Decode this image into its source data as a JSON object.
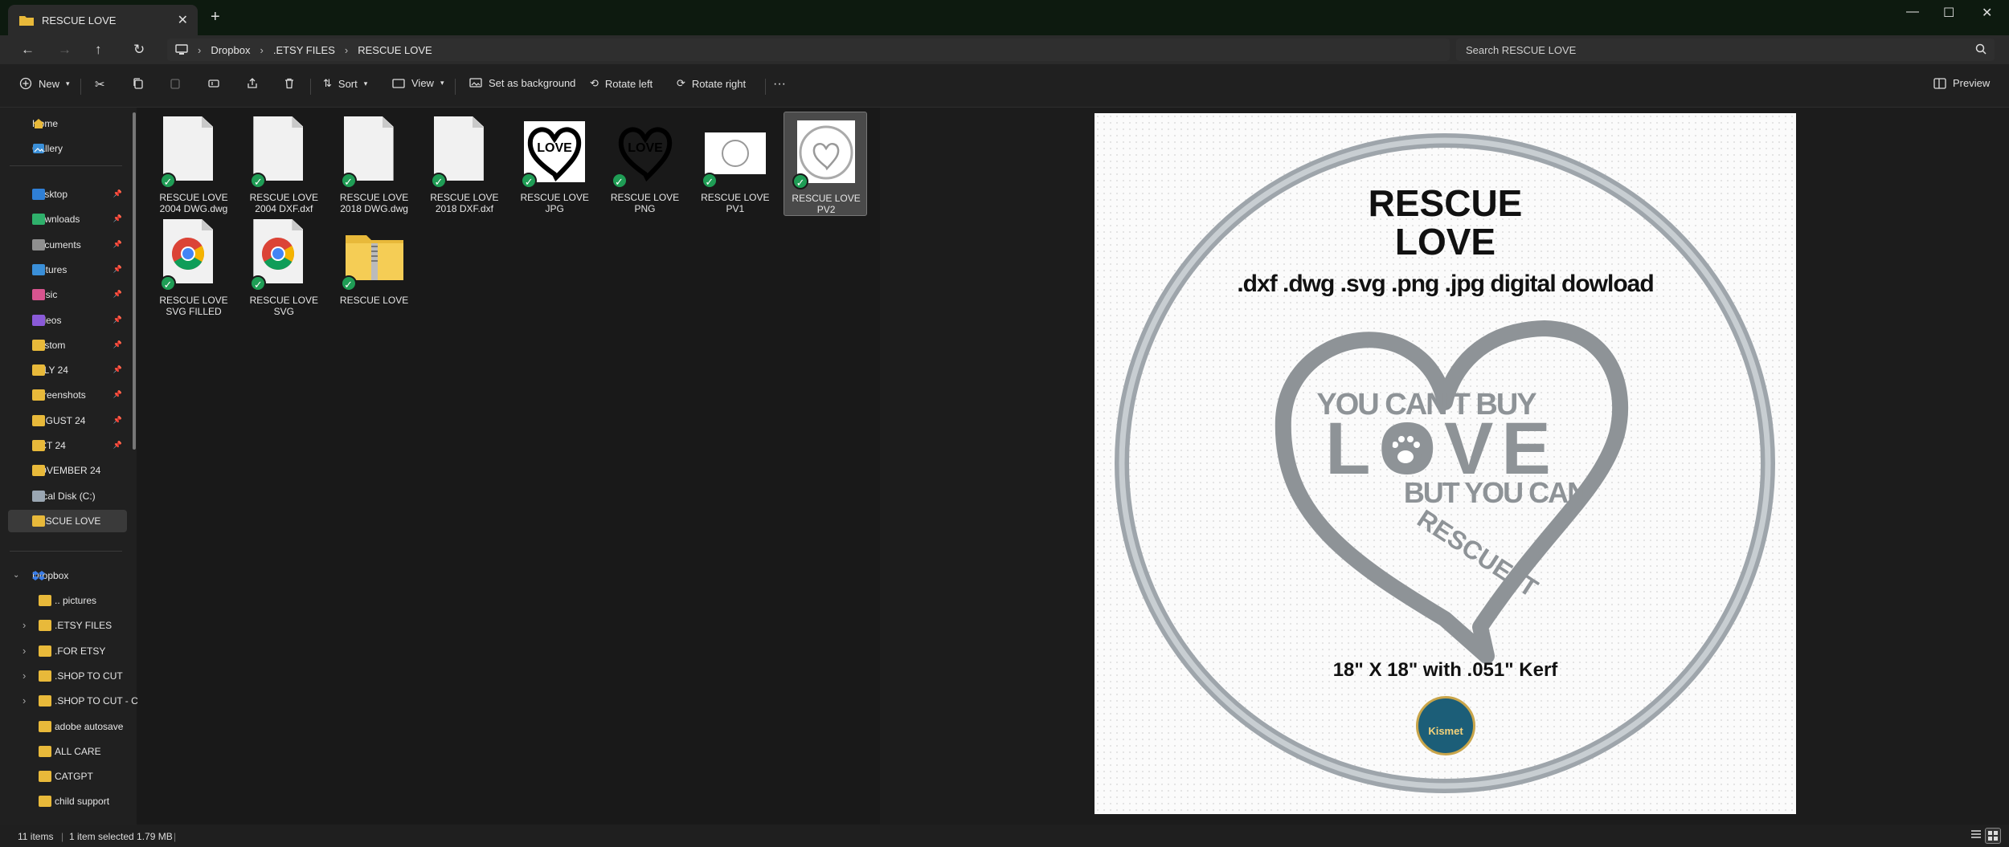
{
  "window": {
    "tab_title": "RESCUE LOVE",
    "new_tab": "+",
    "minimize": "—",
    "maximize": "☐",
    "close": "✕"
  },
  "address": {
    "breadcrumbs": [
      "Dropbox",
      ".ETSY FILES",
      "RESCUE LOVE"
    ],
    "search_placeholder": "Search RESCUE LOVE"
  },
  "toolbar": {
    "new_label": "New",
    "sort_label": "Sort",
    "view_label": "View",
    "set_background_label": "Set as background",
    "rotate_left_label": "Rotate left",
    "rotate_right_label": "Rotate right",
    "more_label": "···",
    "preview_label": "Preview"
  },
  "nav": {
    "home": "Home",
    "gallery": "Gallery",
    "pinned": [
      {
        "label": "Desktop",
        "color": "#2f7fd6"
      },
      {
        "label": "Downloads",
        "color": "#2fb06b"
      },
      {
        "label": "Documents",
        "color": "#8f8f8f"
      },
      {
        "label": "Pictures",
        "color": "#3a8fd8"
      },
      {
        "label": "Music",
        "color": "#d7548f"
      },
      {
        "label": "Videos",
        "color": "#8a5ad8"
      },
      {
        "label": "Custom",
        "color": "#e8b93a"
      },
      {
        "label": "JULY 24",
        "color": "#e8b93a"
      },
      {
        "label": "Screenshots",
        "color": "#e8b93a"
      },
      {
        "label": "AUGUST 24",
        "color": "#e8b93a"
      },
      {
        "label": "OCT 24",
        "color": "#e8b93a"
      },
      {
        "label": "NOVEMBER 24",
        "color": "#e8b93a"
      },
      {
        "label": "Local Disk (C:)",
        "color": "#9aa6b2"
      },
      {
        "label": "RESCUE LOVE",
        "color": "#e8b93a"
      }
    ],
    "dropbox": "Dropbox",
    "dropbox_children": [
      ".. pictures",
      ".ETSY FILES",
      ".FOR ETSY",
      ".SHOP TO CUT",
      ".SHOP TO CUT - C",
      "adobe autosave",
      "ALL CARE",
      "CATGPT",
      "child support"
    ]
  },
  "files": [
    {
      "line1": "RESCUE LOVE",
      "line2": "2004 DWG.dwg"
    },
    {
      "line1": "RESCUE LOVE",
      "line2": "2004 DXF.dxf"
    },
    {
      "line1": "RESCUE LOVE",
      "line2": "2018 DWG.dwg"
    },
    {
      "line1": "RESCUE LOVE",
      "line2": "2018 DXF.dxf"
    },
    {
      "line1": "RESCUE LOVE",
      "line2": "JPG"
    },
    {
      "line1": "RESCUE LOVE",
      "line2": "PNG"
    },
    {
      "line1": "RESCUE LOVE",
      "line2": "PV1"
    },
    {
      "line1": "RESCUE LOVE",
      "line2": "PV2"
    },
    {
      "line1": "RESCUE LOVE",
      "line2": "SVG FILLED"
    },
    {
      "line1": "RESCUE LOVE",
      "line2": "SVG"
    },
    {
      "line1": "RESCUE LOVE",
      "line2": ""
    }
  ],
  "preview": {
    "title_line1": "RESCUE",
    "title_line2": "LOVE",
    "formats": ".dxf .dwg .svg .png .jpg digital dowload",
    "heart_line1": "YOU CAN'T BUY",
    "heart_line2": "LOVE",
    "heart_line3": "BUT YOU CAN",
    "heart_line4": "RESCUE IT",
    "size": "18\" X 18\" with .051\" Kerf",
    "logo_text": "Kismet"
  },
  "status": {
    "items": "11 items",
    "selected": "1 item selected  1.79 MB"
  }
}
